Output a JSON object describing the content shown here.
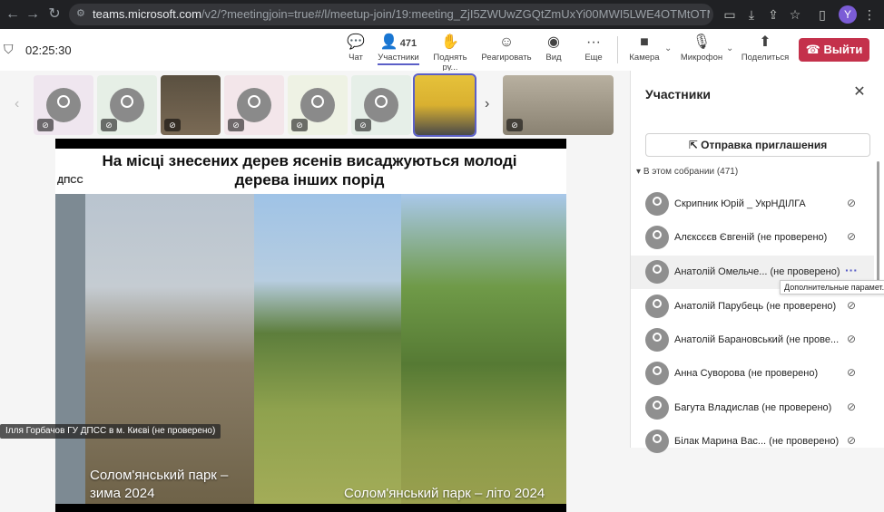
{
  "browser": {
    "url_host": "teams.microsoft.com",
    "url_path": "/v2/?meetingjoin=true#/l/meetup-join/19:meeting_ZjI5ZWUwZGQtZmUxYi00MWI5LWE4OTMtOTM2ZTQyNjI3YT...",
    "profile_initial": "Y"
  },
  "toolbar": {
    "timer": "02:25:30",
    "chat": "Чат",
    "participants_count": "471",
    "participants": "Участники",
    "raise_hand": "Поднять ру...",
    "react": "Реагировать",
    "view": "Вид",
    "more": "Еще",
    "camera": "Камера",
    "mic": "Микрофон",
    "share": "Поделиться",
    "leave": "Выйти"
  },
  "slide": {
    "title": "На місці знесених дерев ясенів висаджуються молоді дерева інших порід",
    "caption_left": "Солом'янський парк – зима 2024",
    "caption_right": "Солом'янський парк – літо 2024",
    "brand": "ДПСС"
  },
  "presenter_label": "Ілля Горбачов ГУ ДПСС в м. Києві (не проверено)",
  "panel": {
    "title": "Участники",
    "invite": "Отправка приглашения",
    "section": "В этом собрании (471)",
    "tooltip": "Дополнительные парамет...",
    "people": [
      "Скрипник Юрій _ УкрНДІЛГА",
      "Алєксєєв Євгеній (не проверено)",
      "Анатолій Омельче... (не проверено)",
      "Анатолій Парубець (не проверено)",
      "Анатолій Барановський (не прове...",
      "Анна Суворова (не проверено)",
      "Багута Владислав (не проверено)",
      "Білак Марина Вас... (не проверено)"
    ]
  },
  "colors": {
    "accent": "#5b5fc7",
    "leave": "#c4314b"
  }
}
